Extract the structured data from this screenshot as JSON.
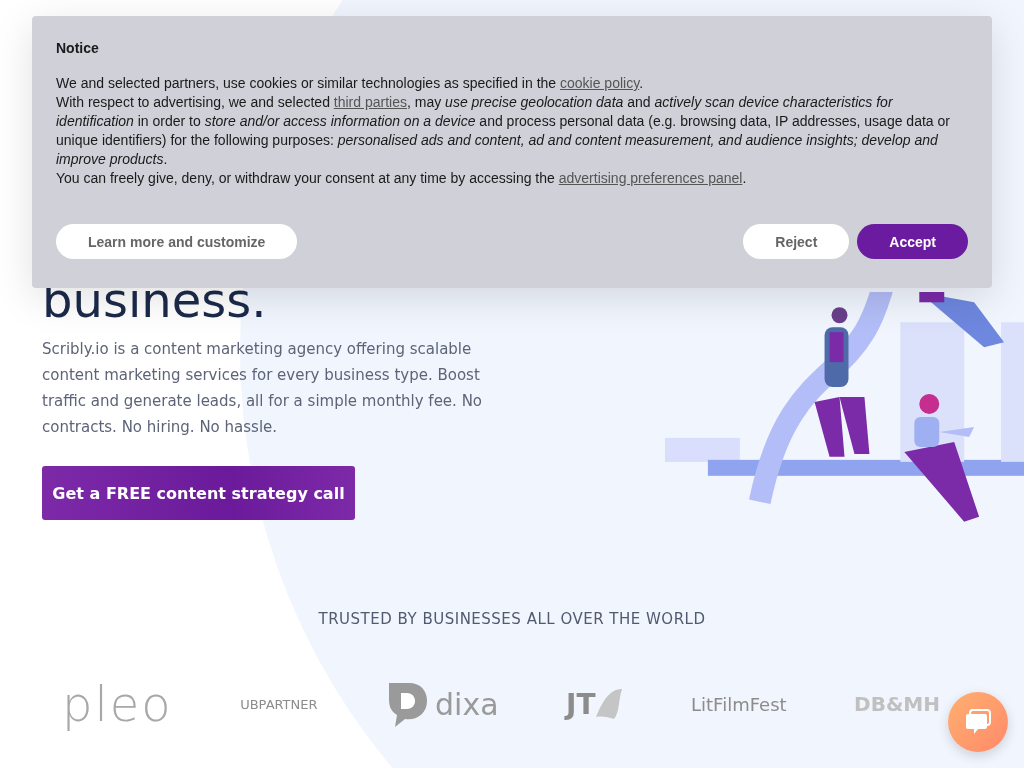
{
  "hero": {
    "heading": "business.",
    "description": "Scribly.io is a content marketing agency offering scalable content marketing services for every business type. Boost traffic and generate leads, all for a simple monthly fee. No contracts. No hiring. No hassle.",
    "cta": "Get a FREE content strategy call"
  },
  "trusted": {
    "heading": "TRUSTED BY BUSINESSES ALL OVER THE WORLD",
    "logos": [
      {
        "kind": "pleo",
        "text": "pleo"
      },
      {
        "kind": "ubpartner",
        "text": "UBPARTNER"
      },
      {
        "kind": "dixa",
        "text": "dixa"
      },
      {
        "kind": "jt",
        "text": "JT"
      },
      {
        "kind": "litfilmfest",
        "text": "LitFilmFest"
      },
      {
        "kind": "dbmh",
        "text": "DB&MH"
      }
    ]
  },
  "notice": {
    "title": "Notice",
    "paragraphs": [
      [
        {
          "kind": "text",
          "text": "We and selected partners, use cookies or similar technologies as specified in the "
        },
        {
          "kind": "link",
          "text": "cookie policy"
        },
        {
          "kind": "text",
          "text": "."
        }
      ],
      [
        {
          "kind": "text",
          "text": "With respect to advertising, we and selected "
        },
        {
          "kind": "link",
          "text": "third parties"
        },
        {
          "kind": "text",
          "text": ", may *use precise geolocation data* and *actively scan device characteristics for identification* in order to *store and/or access information on a device* and process personal data (e.g. browsing data, IP addresses, usage data or unique identifiers) for the following purposes: *personalised ads and content, ad and content measurement, and audience insights; develop and improve products*."
        }
      ],
      [
        {
          "kind": "text",
          "text": "You can freely give, deny, or withdraw your consent at any time by accessing the "
        },
        {
          "kind": "link",
          "text": "advertising preferences panel"
        },
        {
          "kind": "text",
          "text": "."
        }
      ]
    ],
    "buttons": [
      {
        "kind": "secondary",
        "label": "Learn more and customize"
      },
      {
        "kind": "secondary",
        "label": "Reject"
      },
      {
        "kind": "primary",
        "label": "Accept"
      }
    ]
  }
}
